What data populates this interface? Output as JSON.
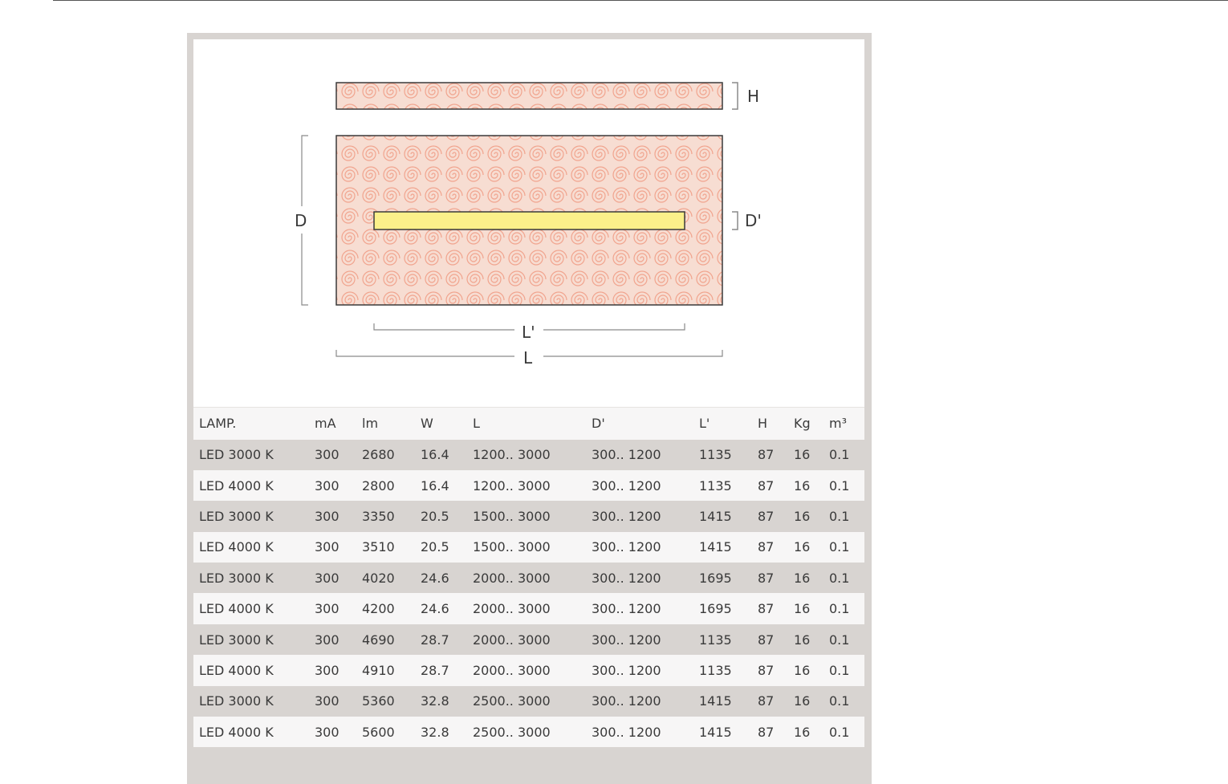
{
  "diagram": {
    "label_h": "H",
    "label_d": "D",
    "label_d_prime": "D'",
    "label_l_prime": "L'",
    "label_l": "L",
    "colors": {
      "panel_fill": "#f7ddd2",
      "swirl": "#f1a48e",
      "lamp_fill": "#fbf08a",
      "outline": "#3a3a3a",
      "dimension": "#8a8a8a"
    }
  },
  "table": {
    "headers": [
      "LAMP.",
      "mA",
      "lm",
      "W",
      "L",
      "D'",
      "L'",
      "H",
      "Kg",
      "m³"
    ],
    "rows": [
      [
        "LED 3000 K",
        "300",
        "2680",
        "16.4",
        "1200.. 3000",
        "300.. 1200",
        "1135",
        "87",
        "16",
        "0.1"
      ],
      [
        "LED 4000 K",
        "300",
        "2800",
        "16.4",
        "1200.. 3000",
        "300.. 1200",
        "1135",
        "87",
        "16",
        "0.1"
      ],
      [
        "LED 3000 K",
        "300",
        "3350",
        "20.5",
        "1500.. 3000",
        "300.. 1200",
        "1415",
        "87",
        "16",
        "0.1"
      ],
      [
        "LED 4000 K",
        "300",
        "3510",
        "20.5",
        "1500.. 3000",
        "300.. 1200",
        "1415",
        "87",
        "16",
        "0.1"
      ],
      [
        "LED 3000 K",
        "300",
        "4020",
        "24.6",
        "2000.. 3000",
        "300.. 1200",
        "1695",
        "87",
        "16",
        "0.1"
      ],
      [
        "LED 4000 K",
        "300",
        "4200",
        "24.6",
        "2000.. 3000",
        "300.. 1200",
        "1695",
        "87",
        "16",
        "0.1"
      ],
      [
        "LED 3000 K",
        "300",
        "4690",
        "28.7",
        "2000.. 3000",
        "300.. 1200",
        "1135",
        "87",
        "16",
        "0.1"
      ],
      [
        "LED 4000 K",
        "300",
        "4910",
        "28.7",
        "2000.. 3000",
        "300.. 1200",
        "1135",
        "87",
        "16",
        "0.1"
      ],
      [
        "LED 3000 K",
        "300",
        "5360",
        "32.8",
        "2500.. 3000",
        "300.. 1200",
        "1415",
        "87",
        "16",
        "0.1"
      ],
      [
        "LED 4000 K",
        "300",
        "5600",
        "32.8",
        "2500.. 3000",
        "300.. 1200",
        "1415",
        "87",
        "16",
        "0.1"
      ]
    ]
  }
}
